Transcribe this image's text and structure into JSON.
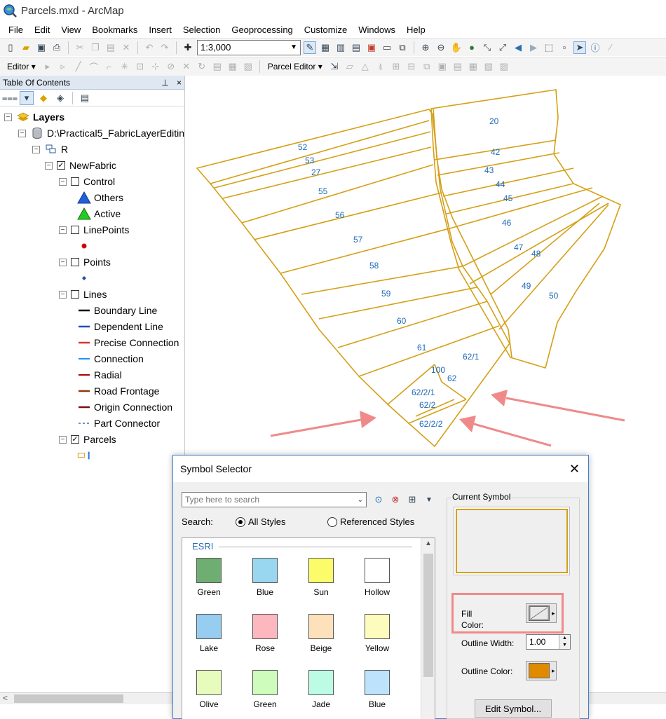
{
  "window": {
    "title": "Parcels.mxd - ArcMap"
  },
  "menu": [
    "File",
    "Edit",
    "View",
    "Bookmarks",
    "Insert",
    "Selection",
    "Geoprocessing",
    "Customize",
    "Windows",
    "Help"
  ],
  "toolbar": {
    "scale": "1:3,000",
    "editor_label": "Editor",
    "parcel_editor_label": "Parcel Editor"
  },
  "toc": {
    "title": "Table Of Contents",
    "pin": "⊥",
    "close": "×",
    "items": [
      {
        "label": "Layers"
      },
      {
        "label": "D:\\Practical5_FabricLayerEditin"
      },
      {
        "label": "R"
      },
      {
        "label": "NewFabric"
      },
      {
        "label": "Control"
      },
      {
        "label": "Others"
      },
      {
        "label": "Active"
      },
      {
        "label": "LinePoints"
      },
      {
        "label": "Points"
      },
      {
        "label": "Lines"
      },
      {
        "label": "Boundary Line"
      },
      {
        "label": "Dependent Line"
      },
      {
        "label": "Precise Connection"
      },
      {
        "label": "Connection"
      },
      {
        "label": "Radial"
      },
      {
        "label": "Road Frontage"
      },
      {
        "label": "Origin Connection"
      },
      {
        "label": "Part Connector"
      },
      {
        "label": "Parcels"
      }
    ],
    "line_colors": {
      "boundary": "#000000",
      "dependent": "#1f4fb0",
      "precise": "#e03030",
      "connection": "#1e90ff",
      "radial": "#b00000",
      "road": "#8b3a0a",
      "origin": "#7a1010",
      "part": "#3a6fb5"
    }
  },
  "map": {
    "parcel_outline_color": "#d4a017",
    "label_color": "#1f6bb5",
    "arrow_color": "#f08a8a",
    "labels": [
      "20",
      "52",
      "53",
      "27",
      "55",
      "42",
      "43",
      "44",
      "45",
      "56",
      "46",
      "57",
      "47",
      "48",
      "58",
      "49",
      "59",
      "50",
      "60",
      "61",
      "62/1",
      "100",
      "62",
      "62/2/1",
      "62/2",
      "62/2/2"
    ]
  },
  "dialog": {
    "title": "Symbol Selector",
    "close": "✕",
    "search_placeholder": "Type here to search",
    "search_label": "Search:",
    "radio_all": "All Styles",
    "radio_referenced": "Referenced Styles",
    "group": "ESRI",
    "swatches": [
      {
        "name": "Green",
        "color": "#6fae73"
      },
      {
        "name": "Blue",
        "color": "#99d6f0"
      },
      {
        "name": "Sun",
        "color": "#fcfc6a"
      },
      {
        "name": "Hollow",
        "color": "#ffffff"
      },
      {
        "name": "Lake",
        "color": "#96cdf0"
      },
      {
        "name": "Rose",
        "color": "#fcb7bf"
      },
      {
        "name": "Beige",
        "color": "#fce1bb"
      },
      {
        "name": "Yellow",
        "color": "#fdfcbd"
      },
      {
        "name": "Olive",
        "color": "#e7fcbc"
      },
      {
        "name": "Green",
        "color": "#cdfcbc"
      },
      {
        "name": "Jade",
        "color": "#bdfce4"
      },
      {
        "name": "Blue",
        "color": "#bde2fc"
      }
    ],
    "current_symbol_label": "Current Symbol",
    "fill_color_label_1": "Fill",
    "fill_color_label_2": "Color:",
    "outline_width_label": "Outline Width:",
    "outline_width_value": "1.00",
    "outline_color_label": "Outline Color:",
    "outline_color": "#e08a00",
    "edit_button": "Edit Symbol..."
  }
}
